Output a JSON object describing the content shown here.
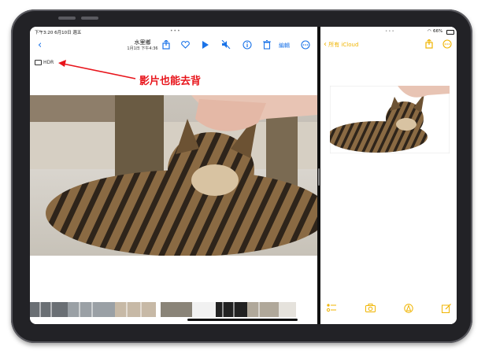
{
  "status_bar": {
    "time": "下午3:20  6月10日 週五",
    "battery": "66%"
  },
  "photos_app": {
    "title": "水里鄉",
    "subtitle": "1月1日 下午4:36",
    "edit_label": "編輯",
    "hdr_label": "HDR",
    "annotation": "影片也能去背"
  },
  "notes_app": {
    "back_label": "所有 iCloud"
  },
  "icons": {
    "back": "chevron-left-icon",
    "share": "share-icon",
    "favorite": "heart-icon",
    "play": "play-icon",
    "mute": "speaker-mute-icon",
    "info": "info-icon",
    "delete": "trash-icon",
    "more": "ellipsis-circle-icon"
  },
  "colors": {
    "accent_blue": "#1a73e8",
    "accent_yellow": "#f0b400",
    "annotation_red": "#e8141b"
  }
}
